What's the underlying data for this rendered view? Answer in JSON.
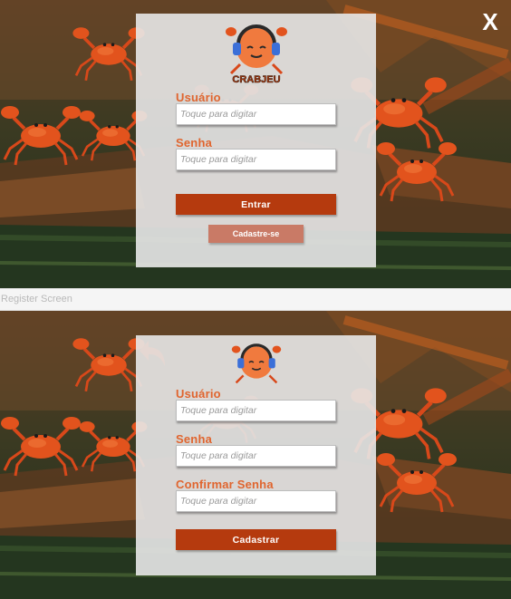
{
  "login": {
    "logo_text": "CRABJEU",
    "username": {
      "label": "Usuário",
      "placeholder": "Toque para digitar"
    },
    "password": {
      "label": "Senha",
      "placeholder": "Toque para digitar"
    },
    "enter_label": "Entrar",
    "signup_label": "Cadastre-se",
    "close_label": "X"
  },
  "divider": {
    "title": "Register Screen"
  },
  "register": {
    "username": {
      "label": "Usuário",
      "placeholder": "Toque para digitar"
    },
    "password": {
      "label": "Senha",
      "placeholder": "Toque para digitar"
    },
    "confirm_password": {
      "label": "Confirmar Senha",
      "placeholder": "Toque para digitar"
    },
    "submit_label": "Cadastrar"
  },
  "colors": {
    "accent": "#e0652f",
    "primary_button": "#b53a0e",
    "secondary_button": "#c97a66",
    "panel": "#e8e8e8"
  }
}
